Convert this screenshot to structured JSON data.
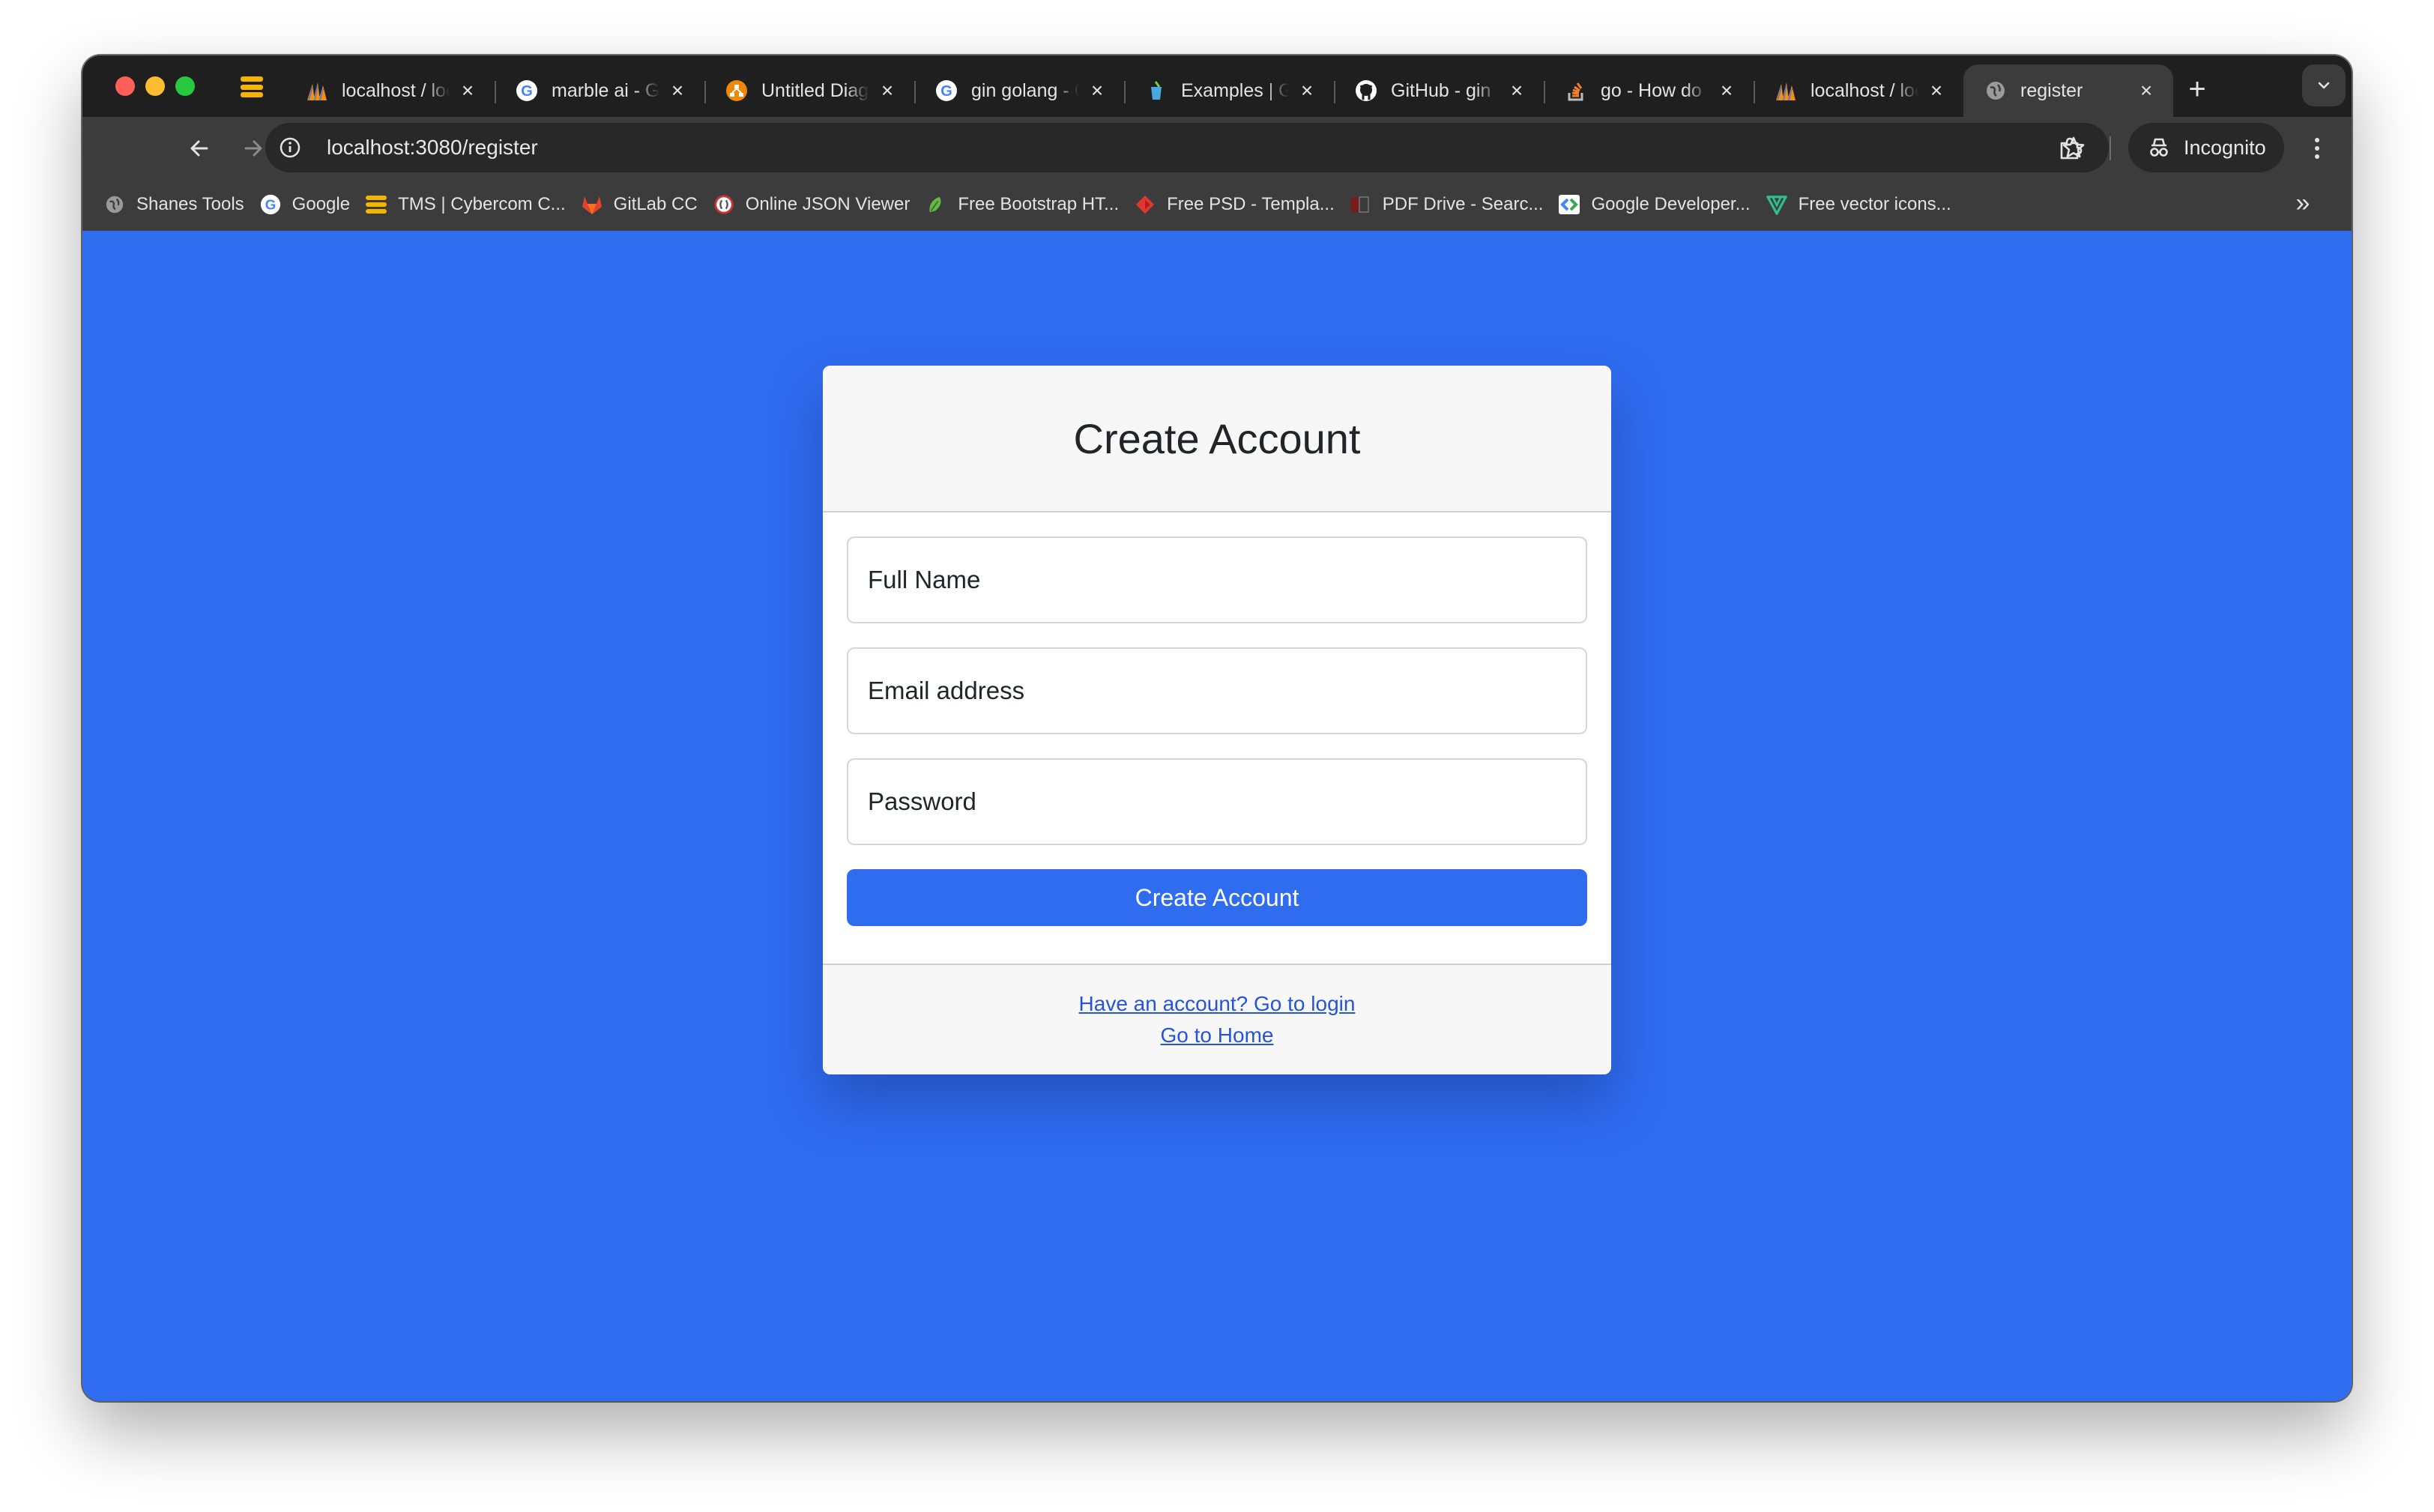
{
  "browser": {
    "tabs": [
      {
        "title": "localhost / localhost",
        "icon": "phpmyadmin-icon",
        "active": false
      },
      {
        "title": "marble ai - Google",
        "icon": "google-icon",
        "active": false
      },
      {
        "title": "Untitled Diagram",
        "icon": "diagram-icon",
        "active": false
      },
      {
        "title": "gin golang - Google",
        "icon": "google-icon",
        "active": false
      },
      {
        "title": "Examples | Gin",
        "icon": "gin-icon",
        "active": false
      },
      {
        "title": "GitHub - gin",
        "icon": "github-icon",
        "active": false
      },
      {
        "title": "go - How do",
        "icon": "stackoverflow-icon",
        "active": false
      },
      {
        "title": "localhost / localhost",
        "icon": "phpmyadmin-icon",
        "active": false
      },
      {
        "title": "register",
        "icon": "globe-icon",
        "active": true
      }
    ],
    "new_tab_label": "+",
    "url": "localhost:3080/register",
    "incognito_label": "Incognito",
    "bookmarks": [
      {
        "label": "Shanes Tools",
        "icon": "globe-icon"
      },
      {
        "label": "Google",
        "icon": "google-icon"
      },
      {
        "label": "TMS | Cybercom C...",
        "icon": "stack-icon"
      },
      {
        "label": "GitLab CC",
        "icon": "gitlab-icon"
      },
      {
        "label": "Online JSON Viewer",
        "icon": "json-viewer-icon"
      },
      {
        "label": "Free Bootstrap HT...",
        "icon": "bootstrap-leaf-icon"
      },
      {
        "label": "Free PSD - Templa...",
        "icon": "psd-icon"
      },
      {
        "label": "PDF Drive - Searc...",
        "icon": "pdf-drive-icon"
      },
      {
        "label": "Google Developer...",
        "icon": "google-developers-icon"
      },
      {
        "label": "Free vector icons...",
        "icon": "vector-icon"
      }
    ]
  },
  "colors": {
    "page_background": "#2f6cf0",
    "primary_button": "#2f6cf0",
    "link": "#2554d9"
  },
  "register": {
    "title": "Create Account",
    "full_name_placeholder": "Full Name",
    "email_placeholder": "Email address",
    "password_placeholder": "Password",
    "submit_label": "Create Account",
    "login_link": "Have an account? Go to login",
    "home_link": "Go to Home"
  }
}
